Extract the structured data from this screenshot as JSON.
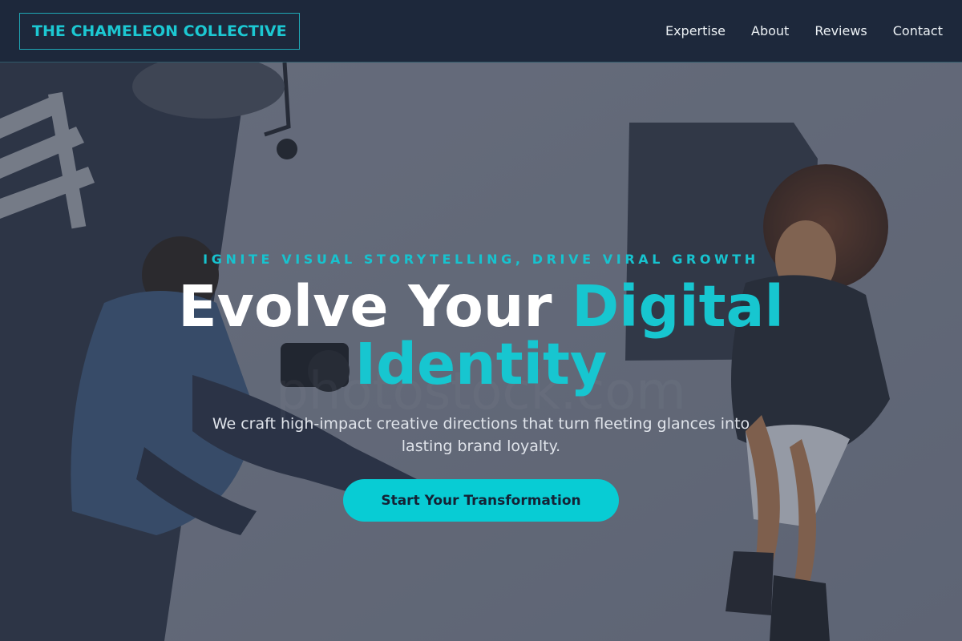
{
  "nav": {
    "logo": "THE CHAMELEON COLLECTIVE",
    "links": [
      "Expertise",
      "About",
      "Reviews",
      "Contact"
    ]
  },
  "hero": {
    "eyebrow": "IGNITE VISUAL STORYTELLING, DRIVE VIRAL GROWTH",
    "headline_white": "Evolve Your ",
    "headline_accent_1": "Digital",
    "headline_accent_2": "Identity",
    "subtitle": "We craft high-impact creative directions that turn fleeting glances into lasting brand loyalty.",
    "cta_label": "Start Your Transformation"
  },
  "colors": {
    "accent": "#17c6d0",
    "nav_bg": "#1d283b",
    "button_bg": "#08ccd4",
    "button_text": "#142235"
  }
}
